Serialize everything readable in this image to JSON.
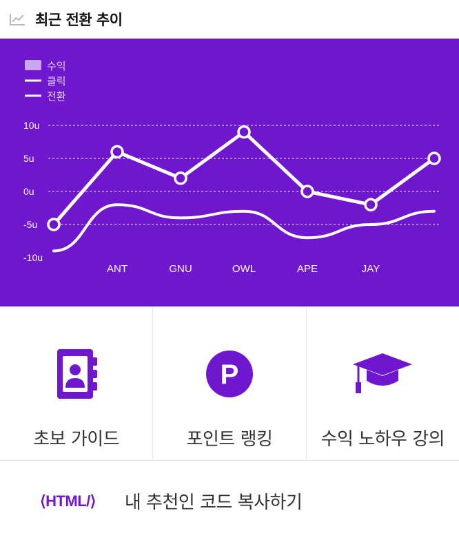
{
  "header": {
    "title": "최근 전환 추이",
    "icon": "line-chart-icon"
  },
  "chart_data": {
    "type": "line",
    "categories": [
      "",
      "ANT",
      "GNU",
      "OWL",
      "APE",
      "JAY",
      ""
    ],
    "ylim": [
      -10,
      10
    ],
    "yticks": [
      "10u",
      "5u",
      "0u",
      "-5u",
      "-10u"
    ],
    "ytick_values": [
      10,
      5,
      0,
      -5,
      -10
    ],
    "legend": {
      "position": "top-left"
    },
    "series": [
      {
        "name": "수익",
        "kind": "area",
        "values": []
      },
      {
        "name": "클릭",
        "kind": "line-markers",
        "values": [
          -5,
          6,
          2,
          9,
          0,
          -2,
          5
        ]
      },
      {
        "name": "전환",
        "kind": "line-smooth",
        "values": [
          -9,
          -2,
          -4,
          -3,
          -7,
          -5,
          -3
        ]
      }
    ],
    "grid": true,
    "colors": {
      "background": "#6f17cf",
      "line": "#ffffff",
      "legend_area": "#c9a6f0"
    }
  },
  "menu": [
    {
      "label": "초보 가이드",
      "icon": "contact-book-icon"
    },
    {
      "label": "포인트 랭킹",
      "icon": "point-p-icon"
    },
    {
      "label": "수익 노하우 강의",
      "icon": "graduation-cap-icon"
    }
  ],
  "code": {
    "tag": "⟨HTML/⟩",
    "label": "내 추천인 코드 복사하기"
  },
  "colors": {
    "accent": "#6f17cf"
  }
}
